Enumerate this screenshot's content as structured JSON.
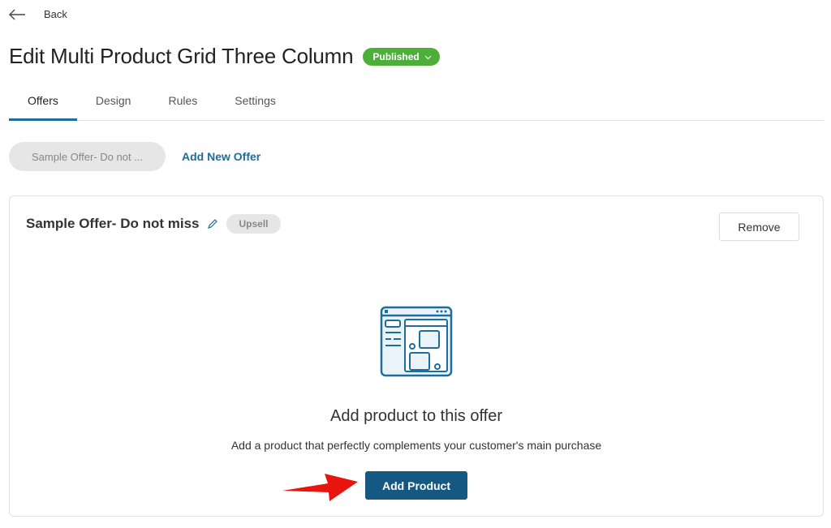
{
  "nav": {
    "back_label": "Back"
  },
  "header": {
    "title": "Edit Multi Product Grid Three Column",
    "status": "Published",
    "status_color": "#4caf3a"
  },
  "tabs": [
    {
      "label": "Offers",
      "active": true
    },
    {
      "label": "Design",
      "active": false
    },
    {
      "label": "Rules",
      "active": false
    },
    {
      "label": "Settings",
      "active": false
    }
  ],
  "offers": {
    "selected_offer": "Sample Offer- Do not ...",
    "add_new_label": "Add New Offer"
  },
  "card": {
    "title": "Sample Offer- Do not miss",
    "type_badge": "Upsell",
    "remove_label": "Remove",
    "empty_title": "Add product to this offer",
    "empty_description": "Add a product that perfectly complements your customer's main purchase",
    "add_product_label": "Add Product",
    "accent_color": "#155982"
  },
  "annotation": {
    "arrow_color": "#e8150f"
  }
}
